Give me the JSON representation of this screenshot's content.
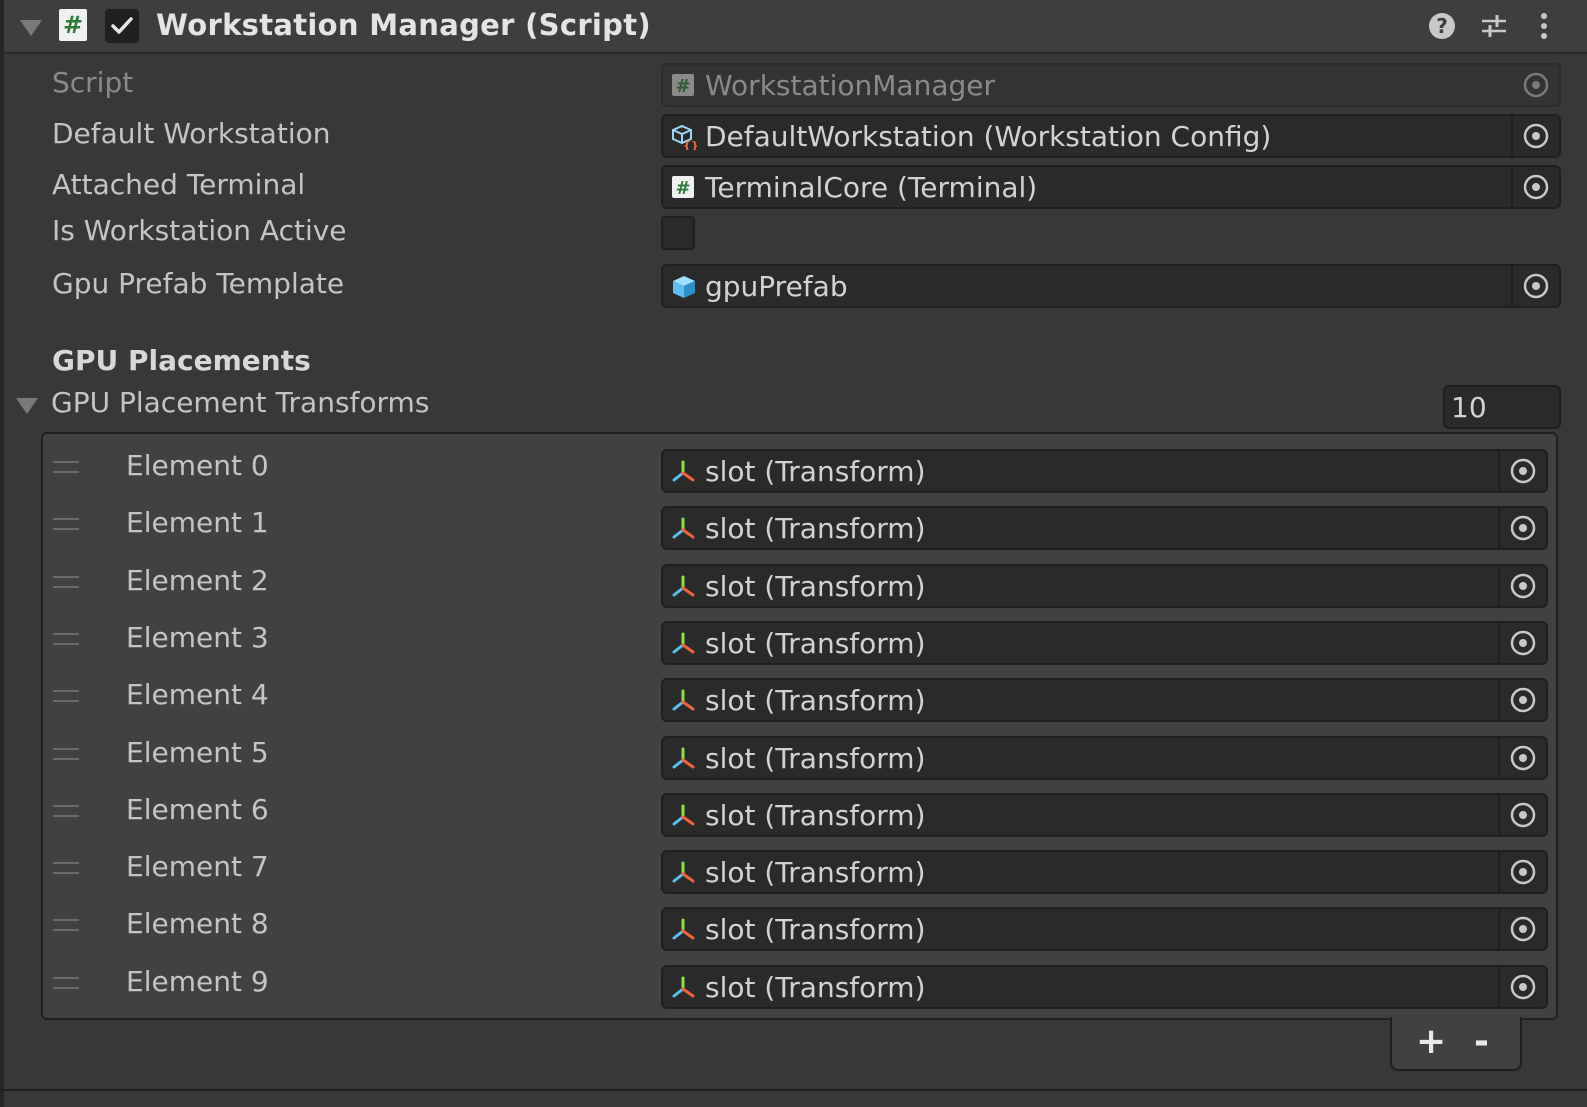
{
  "component": {
    "title": "Workstation Manager (Script)",
    "enabled": true,
    "header_icons": [
      "help-icon",
      "presets-icon",
      "kebab-menu-icon"
    ]
  },
  "properties": {
    "script": {
      "label": "Script",
      "value": "WorkstationManager",
      "icon": "script-icon"
    },
    "default_workstation": {
      "label": "Default Workstation",
      "value": "DefaultWorkstation (Workstation Config)",
      "icon": "scriptable-object-icon"
    },
    "attached_terminal": {
      "label": "Attached Terminal",
      "value": "TerminalCore (Terminal)",
      "icon": "script-icon"
    },
    "is_workstation_active": {
      "label": "Is Workstation Active",
      "checked": false
    },
    "gpu_prefab_template": {
      "label": "Gpu Prefab Template",
      "value": "gpuPrefab",
      "icon": "prefab-cube-icon"
    }
  },
  "gpu_section": {
    "header": "GPU Placements",
    "list_label": "GPU Placement Transforms",
    "size": "10",
    "elements": [
      {
        "label": "Element 0",
        "value": "slot (Transform)"
      },
      {
        "label": "Element 1",
        "value": "slot (Transform)"
      },
      {
        "label": "Element 2",
        "value": "slot (Transform)"
      },
      {
        "label": "Element 3",
        "value": "slot (Transform)"
      },
      {
        "label": "Element 4",
        "value": "slot (Transform)"
      },
      {
        "label": "Element 5",
        "value": "slot (Transform)"
      },
      {
        "label": "Element 6",
        "value": "slot (Transform)"
      },
      {
        "label": "Element 7",
        "value": "slot (Transform)"
      },
      {
        "label": "Element 8",
        "value": "slot (Transform)"
      },
      {
        "label": "Element 9",
        "value": "slot (Transform)"
      }
    ],
    "add_label": "+",
    "remove_label": "-"
  },
  "colors": {
    "panel_bg": "#383838",
    "field_bg": "#2a2a2a",
    "text": "#c4c4c4",
    "script_icon_green": "#2f7a3a",
    "prefab_blue": "#5bc0f0"
  }
}
